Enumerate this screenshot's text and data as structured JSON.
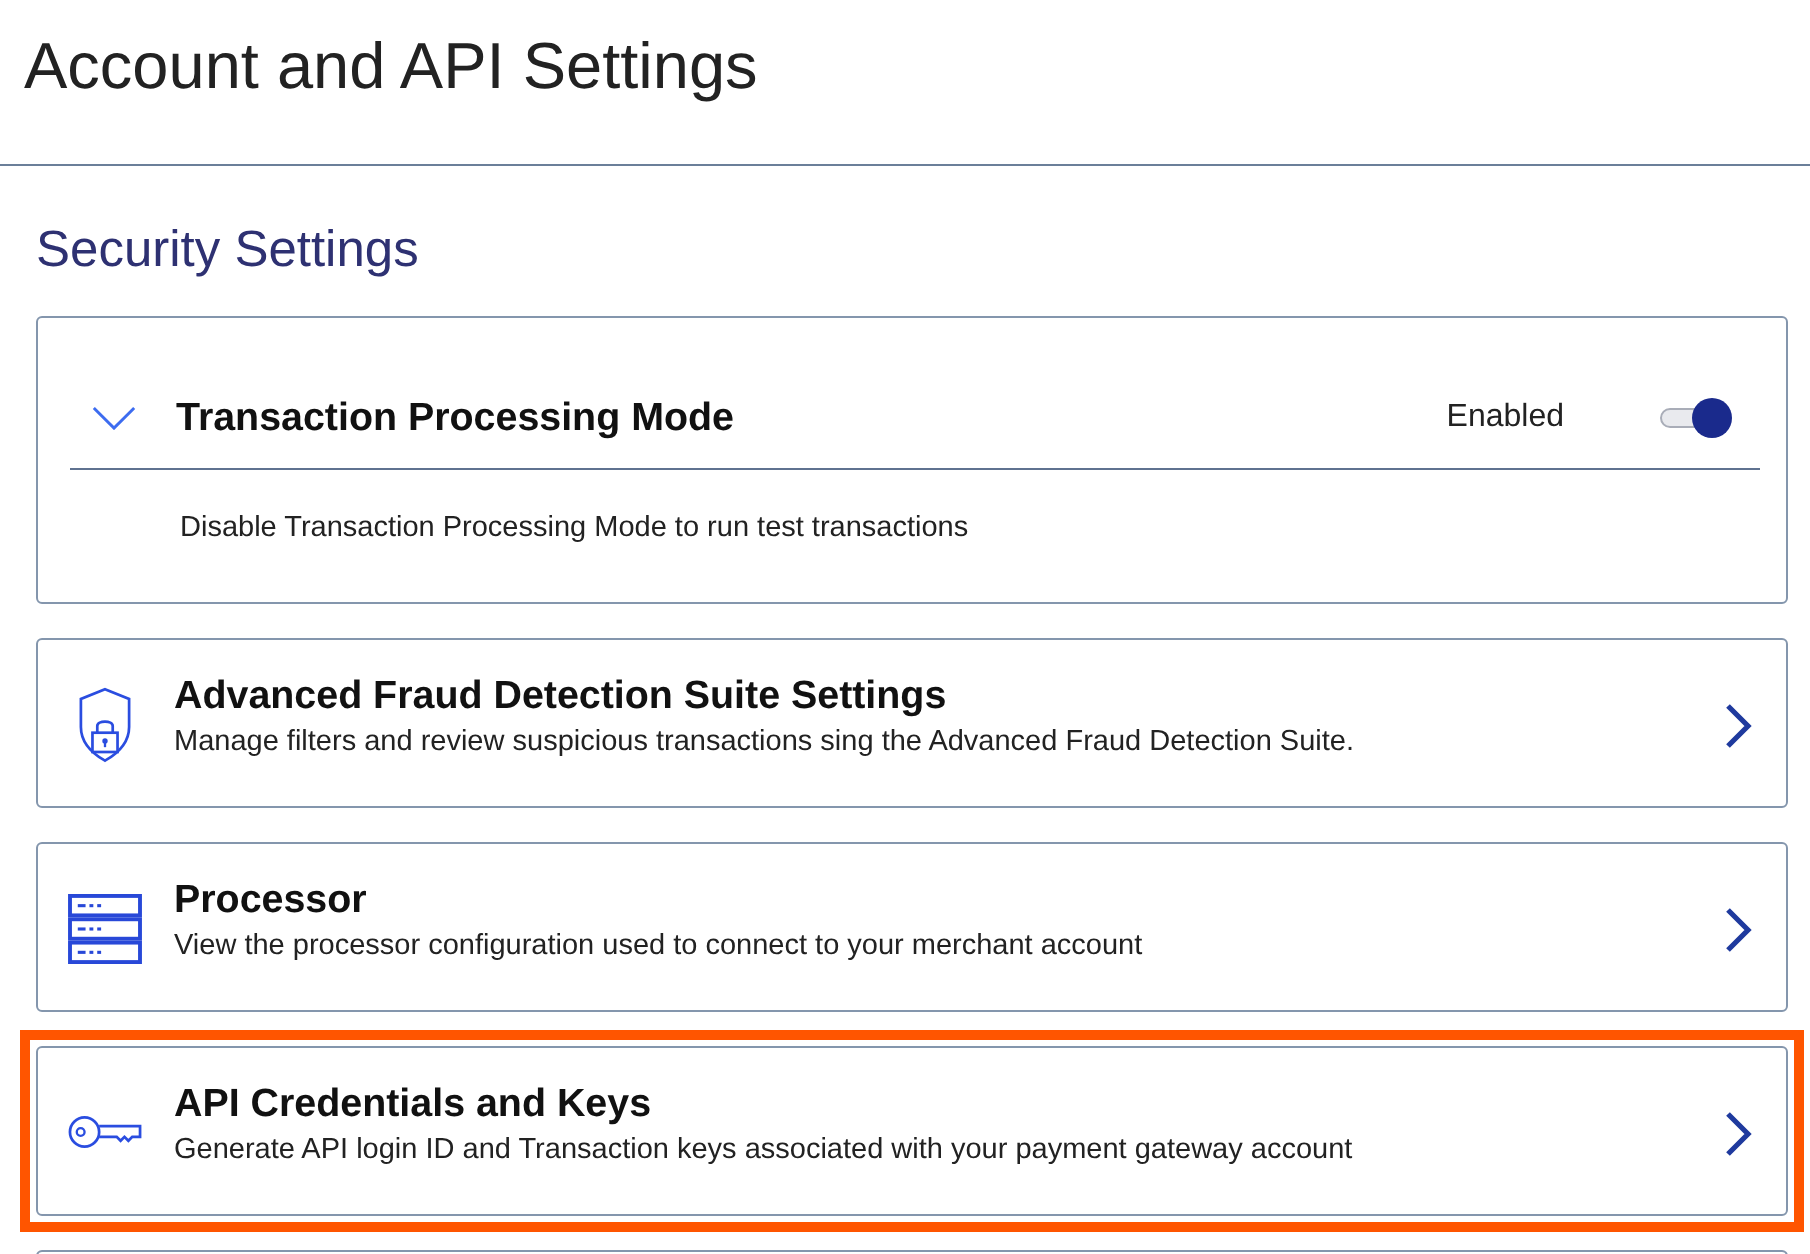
{
  "page_title": "Account and API Settings",
  "section": {
    "title": "Security Settings",
    "cards": [
      {
        "kind": "toggle",
        "title": "Transaction Processing Mode",
        "expanded": true,
        "status": "Enabled",
        "on": true,
        "description": "Disable Transaction Processing Mode to run test transactions",
        "highlighted": false
      },
      {
        "kind": "link",
        "title": "Advanced Fraud Detection Suite Settings",
        "description": "Manage filters and review suspicious transactions sing the Advanced Fraud Detection Suite.",
        "highlighted": false
      },
      {
        "kind": "link",
        "title": "Processor",
        "description": "View the processor configuration used to connect to your merchant account",
        "highlighted": false
      },
      {
        "kind": "link",
        "title": "API Credentials and Keys",
        "description": "Generate API login ID and Transaction keys associated with your payment gateway account",
        "highlighted": true
      }
    ]
  }
}
